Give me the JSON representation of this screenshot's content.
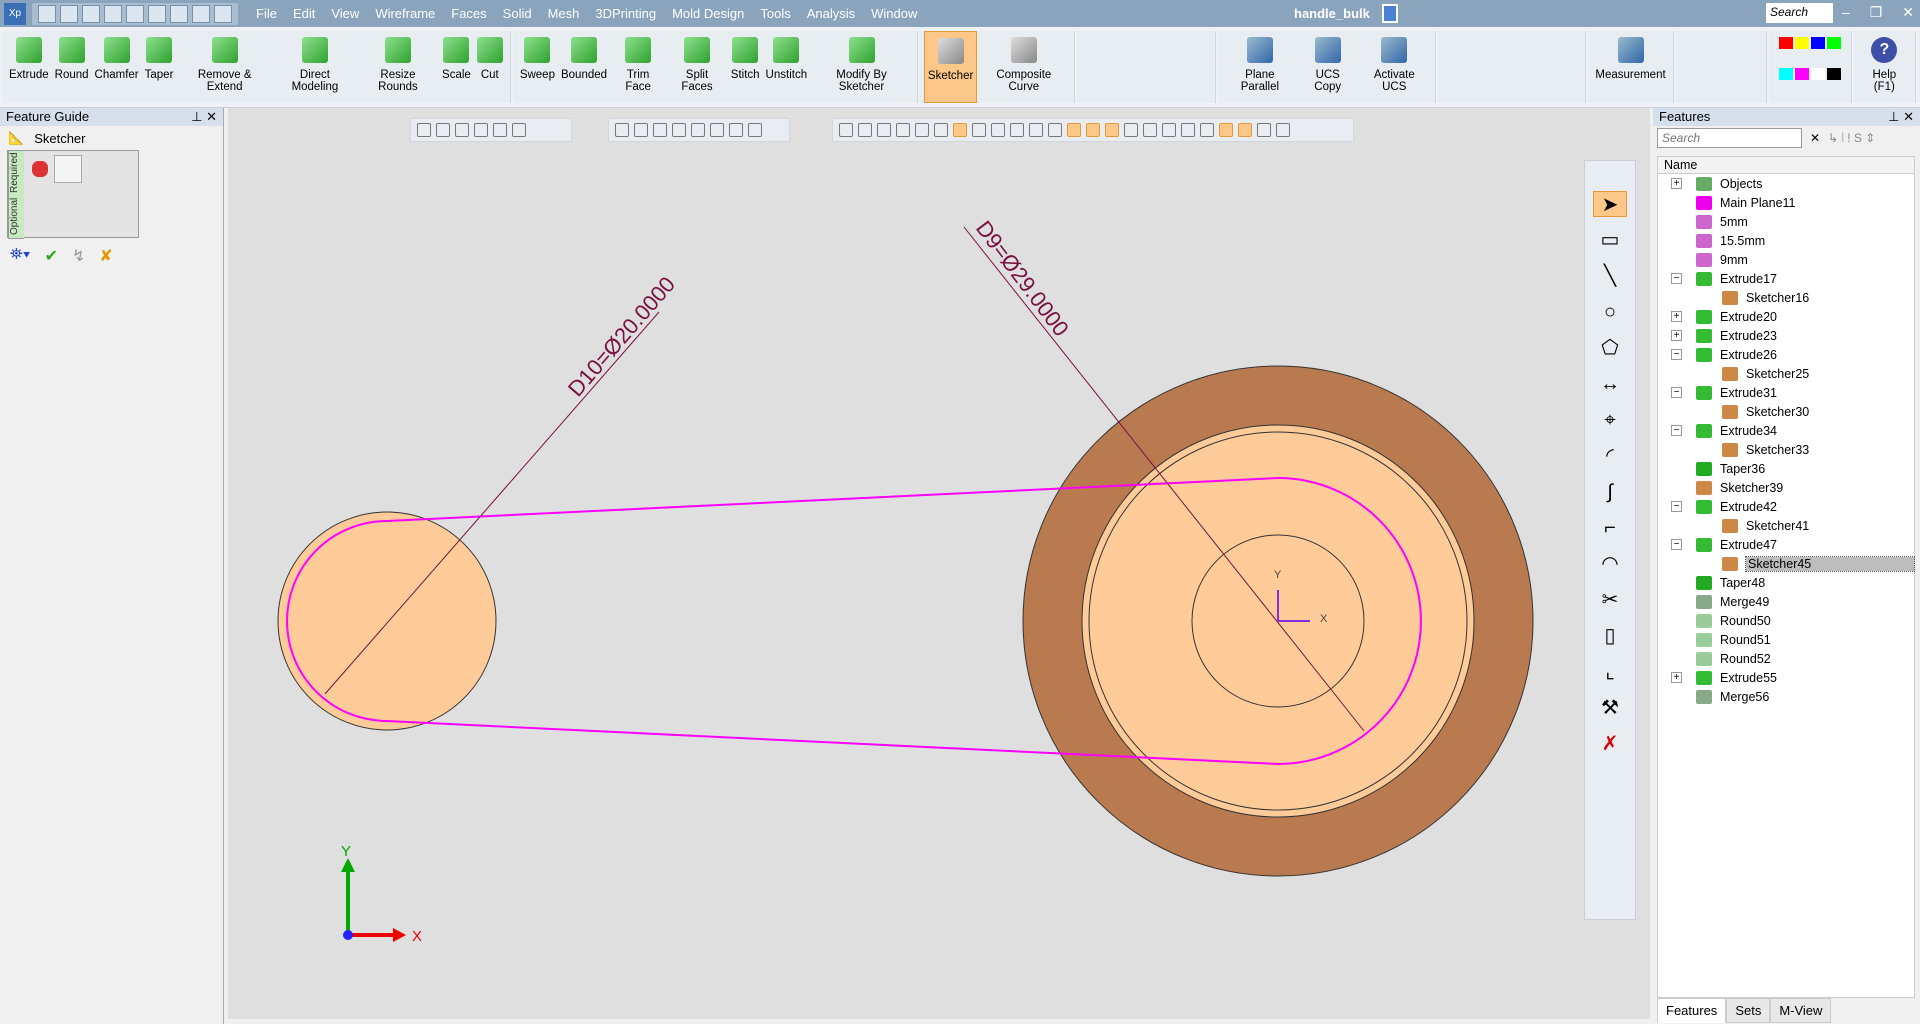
{
  "app": {
    "logo": "Xp",
    "title": "handle_bulk",
    "search_placeholder": "Search"
  },
  "menu": [
    "File",
    "Edit",
    "View",
    "Wireframe",
    "Faces",
    "Solid",
    "Mesh",
    "3DPrinting",
    "Mold Design",
    "Tools",
    "Analysis",
    "Window"
  ],
  "ribbon": {
    "solid": [
      "Extrude",
      "Round",
      "Chamfer",
      "Taper",
      "Remove & Extend",
      "Direct Modeling",
      "Resize Rounds",
      "Scale",
      "Cut"
    ],
    "faces": [
      "Sweep",
      "Bounded",
      "Trim Face",
      "Split Faces",
      "Stitch",
      "Unstitch",
      "Modify By Sketcher"
    ],
    "sketch": [
      "Sketcher",
      "Composite Curve"
    ],
    "ucs": [
      "Plane Parallel",
      "UCS Copy",
      "Activate UCS"
    ],
    "measure": "Measurement",
    "help": "Help (F1)",
    "palette": [
      "#ff0000",
      "#ffff00",
      "#0000ff",
      "#00ff00",
      "#00ffff",
      "#ff00ff",
      "#ffffff",
      "#000000"
    ]
  },
  "feature_guide": {
    "title": "Feature Guide",
    "item": "Sketcher",
    "required": "Required",
    "optional": "Optional"
  },
  "canvas": {
    "dim_small": "D10=Ø20.0000",
    "dim_large": "D9=Ø29.0000",
    "axis_x": "X",
    "axis_y": "Y",
    "ucs_x": "X",
    "ucs_y": "Y",
    "colors": {
      "profile": "#ff00ff",
      "face": "#ffcc99",
      "outer": "#b97a50",
      "dimension": "#7a1040"
    }
  },
  "features": {
    "title": "Features",
    "search_placeholder": "Search",
    "column": "Name",
    "items": [
      {
        "label": "Objects",
        "exp": "+",
        "level": 0,
        "icon": "objects-icon"
      },
      {
        "label": "Main Plane11",
        "exp": "",
        "level": 0,
        "icon": "plane-icon"
      },
      {
        "label": "5mm",
        "exp": "",
        "level": 0,
        "icon": "plane-parallel-icon"
      },
      {
        "label": "15.5mm",
        "exp": "",
        "level": 0,
        "icon": "plane-parallel-icon"
      },
      {
        "label": "9mm",
        "exp": "",
        "level": 0,
        "icon": "plane-parallel-icon"
      },
      {
        "label": "Extrude17",
        "exp": "−",
        "level": 0,
        "icon": "extrude-icon"
      },
      {
        "label": "Sketcher16",
        "exp": "",
        "level": 1,
        "icon": "sketcher-icon"
      },
      {
        "label": "Extrude20",
        "exp": "+",
        "level": 0,
        "icon": "extrude-icon"
      },
      {
        "label": "Extrude23",
        "exp": "+",
        "level": 0,
        "icon": "extrude-icon"
      },
      {
        "label": "Extrude26",
        "exp": "−",
        "level": 0,
        "icon": "extrude-icon"
      },
      {
        "label": "Sketcher25",
        "exp": "",
        "level": 1,
        "icon": "sketcher-icon"
      },
      {
        "label": "Extrude31",
        "exp": "−",
        "level": 0,
        "icon": "extrude-icon"
      },
      {
        "label": "Sketcher30",
        "exp": "",
        "level": 1,
        "icon": "sketcher-icon"
      },
      {
        "label": "Extrude34",
        "exp": "−",
        "level": 0,
        "icon": "extrude-icon"
      },
      {
        "label": "Sketcher33",
        "exp": "",
        "level": 1,
        "icon": "sketcher-icon"
      },
      {
        "label": "Taper36",
        "exp": "",
        "level": 0,
        "icon": "taper-icon"
      },
      {
        "label": "Sketcher39",
        "exp": "",
        "level": 0,
        "icon": "sketcher-icon"
      },
      {
        "label": "Extrude42",
        "exp": "−",
        "level": 0,
        "icon": "extrude-icon"
      },
      {
        "label": "Sketcher41",
        "exp": "",
        "level": 1,
        "icon": "sketcher-icon"
      },
      {
        "label": "Extrude47",
        "exp": "−",
        "level": 0,
        "icon": "extrude-icon"
      },
      {
        "label": "Sketcher45",
        "exp": "",
        "level": 1,
        "icon": "sketcher-icon",
        "selected": true
      },
      {
        "label": "Taper48",
        "exp": "",
        "level": 0,
        "icon": "taper-icon"
      },
      {
        "label": "Merge49",
        "exp": "",
        "level": 0,
        "icon": "merge-icon"
      },
      {
        "label": "Round50",
        "exp": "",
        "level": 0,
        "icon": "round-icon"
      },
      {
        "label": "Round51",
        "exp": "",
        "level": 0,
        "icon": "round-icon"
      },
      {
        "label": "Round52",
        "exp": "",
        "level": 0,
        "icon": "round-icon"
      },
      {
        "label": "Extrude55",
        "exp": "+",
        "level": 0,
        "icon": "extrude-icon"
      },
      {
        "label": "Merge56",
        "exp": "",
        "level": 0,
        "icon": "merge-icon"
      }
    ],
    "tabs": [
      "Features",
      "Sets",
      "M-View"
    ]
  }
}
